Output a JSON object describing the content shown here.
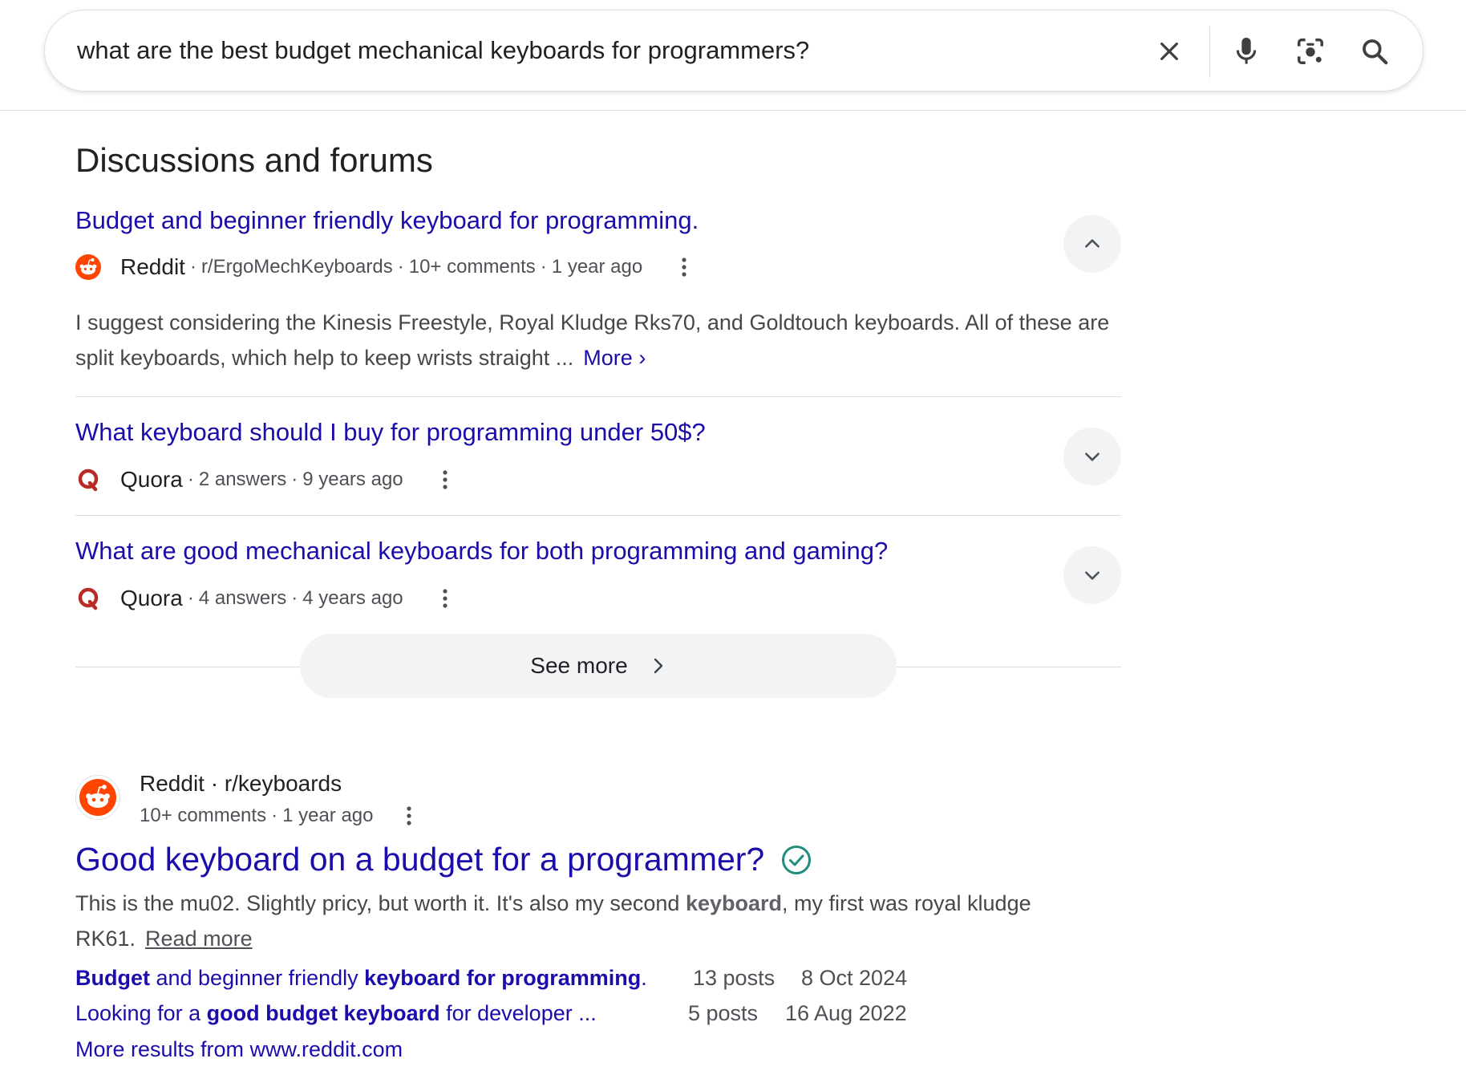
{
  "search": {
    "query": "what are the best budget mechanical keyboards for programmers?",
    "icons": [
      "clear-icon",
      "microphone-icon",
      "lens-camera-icon",
      "search-icon"
    ]
  },
  "discussions": {
    "heading": "Discussions and forums",
    "items": [
      {
        "title": "Budget and beginner friendly keyboard for programming.",
        "site": "Reddit",
        "meta": [
          "r/ErgoMechKeyboards",
          "10+ comments",
          "1 year ago"
        ],
        "expanded": true,
        "snippet": "I suggest considering the Kinesis Freestyle, Royal Kludge Rks70, and Goldtouch keyboards. All of these are split keyboards, which help to keep wrists straight ...",
        "more_label": "More"
      },
      {
        "title": "What keyboard should I buy for programming under 50$?",
        "site": "Quora",
        "meta": [
          "2 answers",
          "9 years ago"
        ],
        "expanded": false
      },
      {
        "title": "What are good mechanical keyboards for both programming and gaming?",
        "site": "Quora",
        "meta": [
          "4 answers",
          "4 years ago"
        ],
        "expanded": false
      }
    ],
    "see_more_label": "See more"
  },
  "result": {
    "source": "Reddit · r/keyboards",
    "meta": [
      "10+ comments",
      "1 year ago"
    ],
    "title": "Good keyboard on a budget for a programmer?",
    "snippet_before": "This is the mu02. Slightly pricy, but worth it. It's also my second ",
    "snippet_bold": "keyboard",
    "snippet_after": ", my first was royal kludge RK61.",
    "read_more": "Read more",
    "sublinks": [
      {
        "parts": [
          {
            "text": "Budget",
            "bold": true
          },
          {
            "text": " and beginner friendly ",
            "bold": false
          },
          {
            "text": "keyboard for programming",
            "bold": true
          },
          {
            "text": ".",
            "bold": false
          }
        ],
        "posts": "13 posts",
        "date": "8 Oct 2024"
      },
      {
        "parts": [
          {
            "text": "Looking for a ",
            "bold": false
          },
          {
            "text": "good budget keyboard",
            "bold": true
          },
          {
            "text": " for developer ...",
            "bold": false
          }
        ],
        "posts": "5 posts",
        "date": "16 Aug 2022"
      }
    ],
    "more_results": "More results from www.reddit.com"
  },
  "colors": {
    "link": "#1a0dab",
    "reddit": "#ff4500",
    "quora": "#b92b27",
    "verified": "#1e8e7e"
  }
}
